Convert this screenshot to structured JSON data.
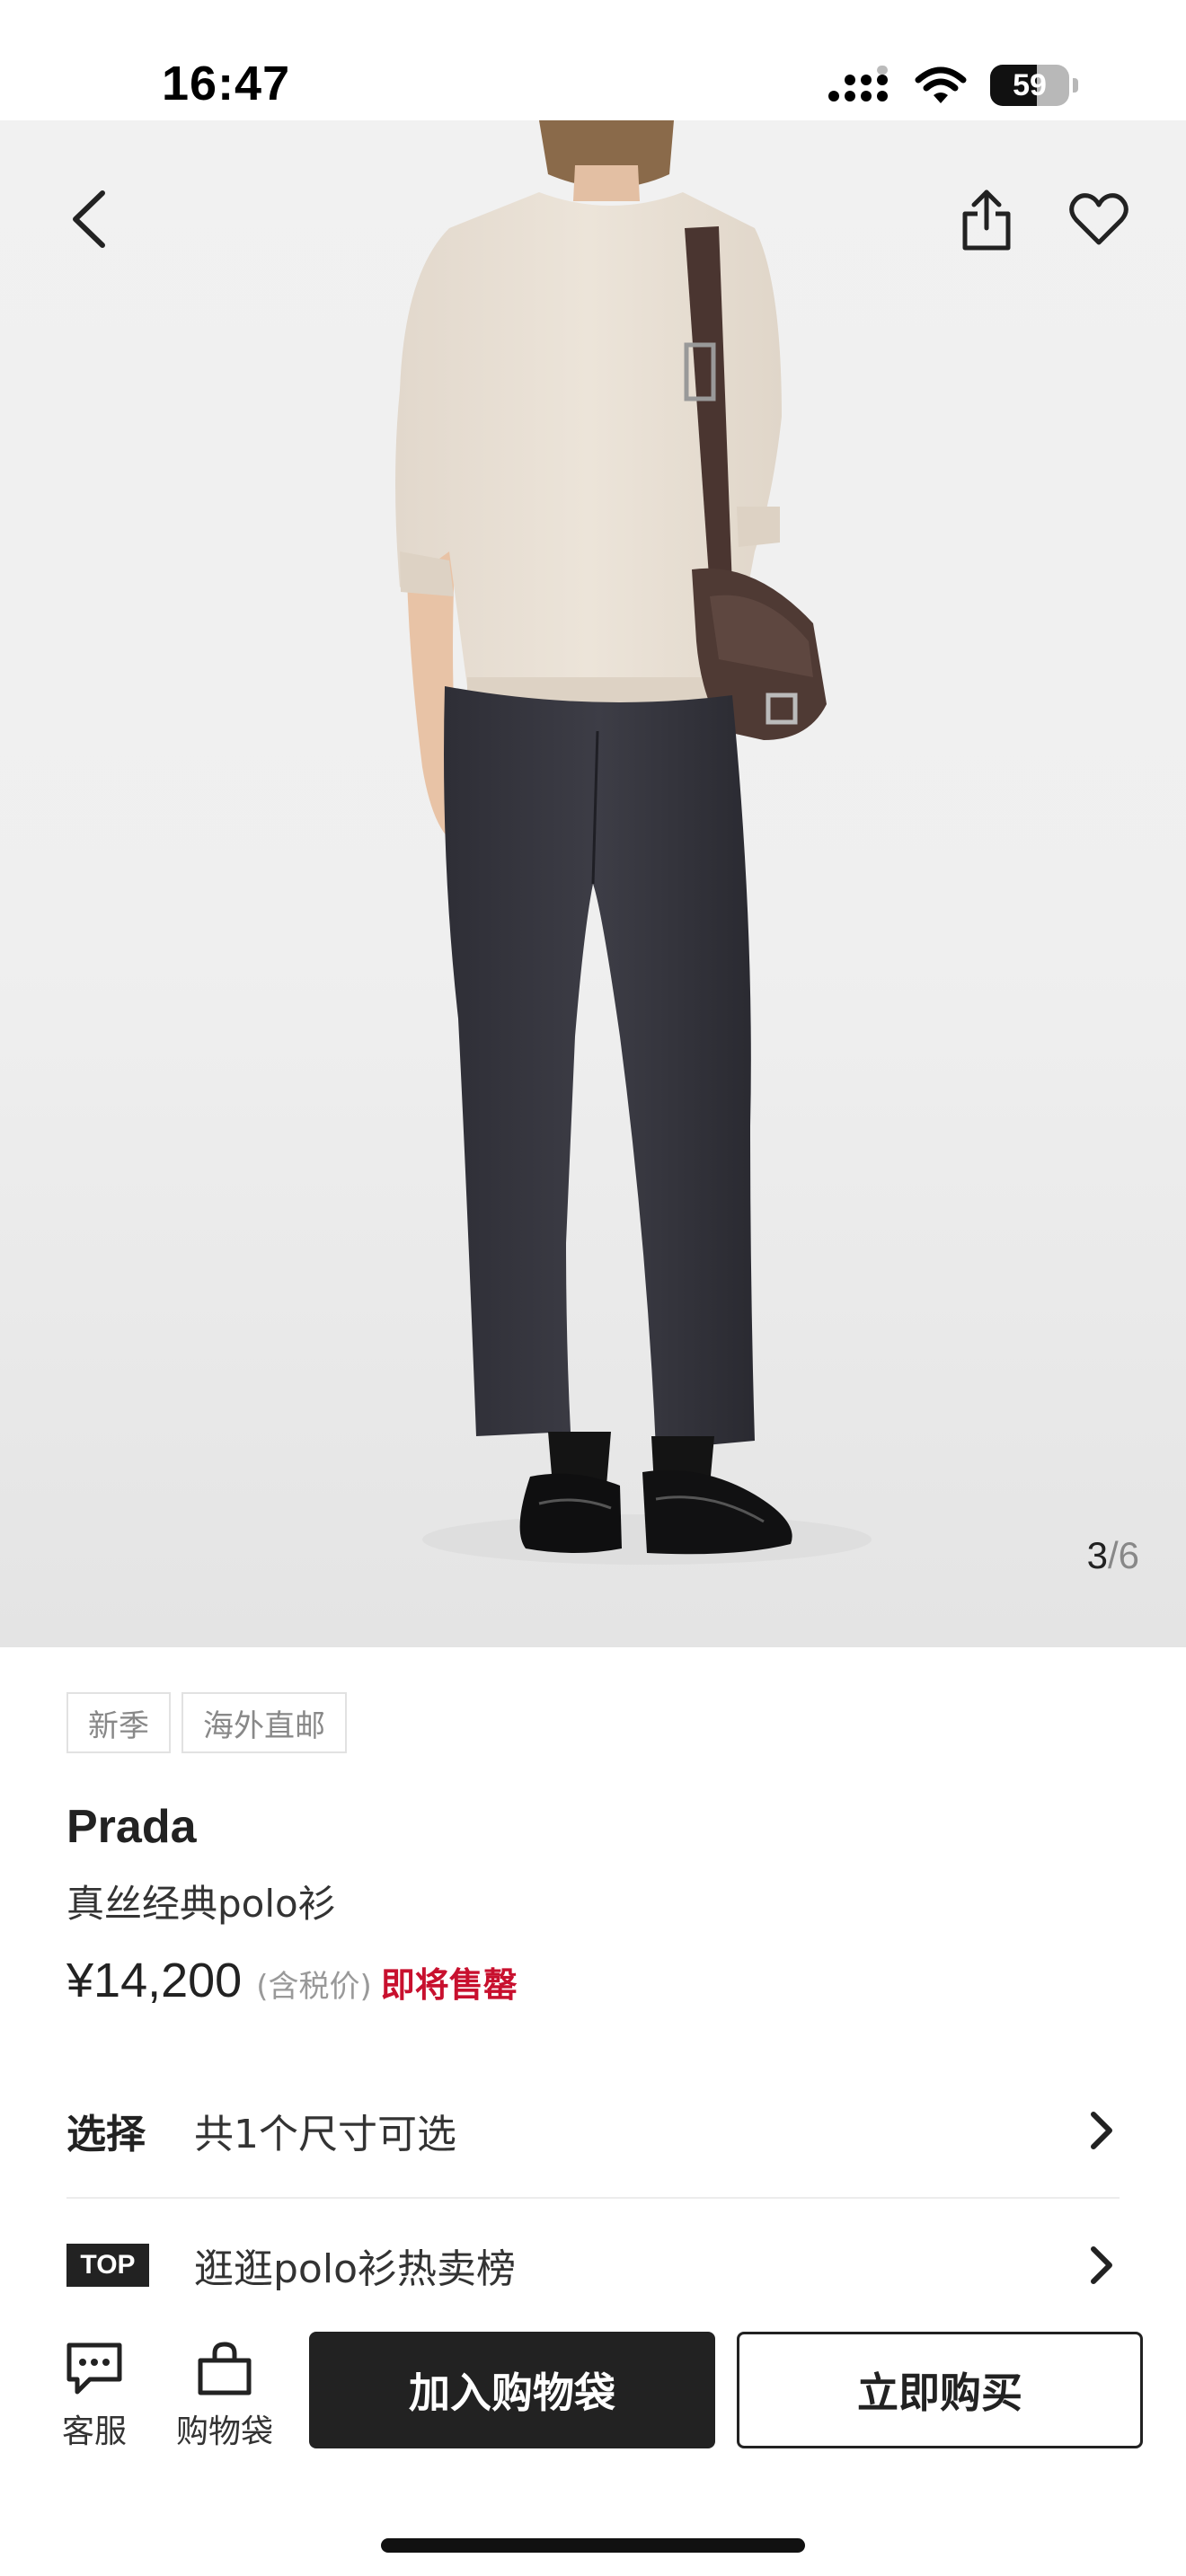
{
  "status_bar": {
    "time": "16:47",
    "battery": "59",
    "icons": [
      "signal-icon",
      "wifi-icon",
      "battery-icon"
    ]
  },
  "gallery": {
    "current": "3",
    "separator": "/",
    "total": "6",
    "icons": [
      "back-arrow-icon",
      "share-icon",
      "heart-icon"
    ]
  },
  "product": {
    "tags": [
      "新季",
      "海外直邮"
    ],
    "brand": "Prada",
    "name": "真丝经典polo衫",
    "price": "¥14,200",
    "tax_note": "(含税价)",
    "stock_status": "即将售罄"
  },
  "options": {
    "select_label": "选择",
    "select_text": "共1个尺寸可选",
    "top_badge": "TOP",
    "top_text": "逛逛polo衫热卖榜"
  },
  "bottom_bar": {
    "service_label": "客服",
    "bag_label": "购物袋",
    "add_to_bag": "加入购物袋",
    "buy_now": "立即购买"
  },
  "colors": {
    "accent_red": "#c8102e",
    "primary_dark": "#222222",
    "image_background": "#efefef"
  }
}
